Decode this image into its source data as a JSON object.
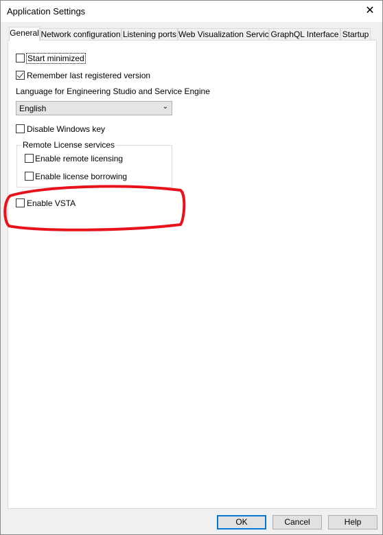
{
  "window": {
    "title": "Application Settings",
    "close_icon": "close-icon"
  },
  "tabs": [
    {
      "label": "General",
      "selected": true
    },
    {
      "label": "Network configuration"
    },
    {
      "label": "Listening ports"
    },
    {
      "label": "Web Visualization Service"
    },
    {
      "label": "GraphQL Interface"
    },
    {
      "label": "Startup"
    }
  ],
  "general": {
    "start_minimized": {
      "label": "Start minimized",
      "checked": false
    },
    "remember_version": {
      "label": "Remember last registered version",
      "checked": true
    },
    "language_label": "Language for Engineering Studio and Service Engine",
    "language_value": "English",
    "disable_windows_key": {
      "label": "Disable Windows key",
      "checked": false
    },
    "remote_group": {
      "title": "Remote License services",
      "remote_licensing": {
        "label": "Enable remote licensing",
        "checked": false
      },
      "license_borrowing": {
        "label": "Enable license borrowing",
        "checked": false
      }
    },
    "enable_vsta": {
      "label": "Enable VSTA",
      "checked": false
    }
  },
  "annotation_color": "#e8121c",
  "buttons": {
    "ok": "OK",
    "cancel": "Cancel",
    "help": "Help"
  }
}
